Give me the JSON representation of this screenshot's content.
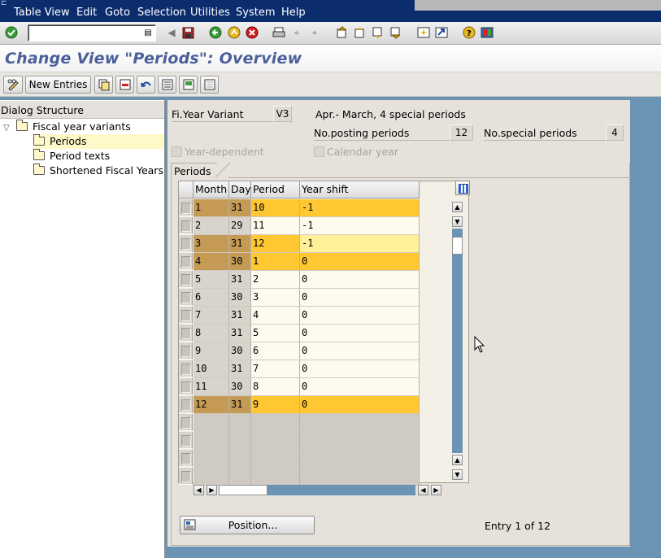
{
  "menubar": {
    "items": [
      "Table View",
      "Edit",
      "Goto",
      "Selection",
      "Utilities",
      "System",
      "Help"
    ]
  },
  "title": "Change View \"Periods\": Overview",
  "apptoolbar": {
    "new_entries": "New Entries"
  },
  "dialog_structure": {
    "header": "Dialog Structure",
    "nodes": [
      "Fiscal year variants",
      "Periods",
      "Period texts",
      "Shortened Fiscal Years"
    ]
  },
  "header_fields": {
    "fy_variant_label": "Fi.Year Variant",
    "fy_variant_value": "V3",
    "fy_variant_desc": "Apr.- March, 4 special periods",
    "posting_periods_label": "No.posting periods",
    "posting_periods_value": "12",
    "special_periods_label": "No.special periods",
    "special_periods_value": "4",
    "year_dependent_label": "Year-dependent",
    "calendar_year_label": "Calendar year"
  },
  "periods_group": {
    "title": "Periods",
    "columns": [
      "Month",
      "Day",
      "Period",
      "Year shift"
    ],
    "rows": [
      {
        "month": "1",
        "day": "31",
        "period": "10",
        "shift": "-1"
      },
      {
        "month": "2",
        "day": "29",
        "period": "11",
        "shift": "-1"
      },
      {
        "month": "3",
        "day": "31",
        "period": "12",
        "shift": "-1"
      },
      {
        "month": "4",
        "day": "30",
        "period": "1",
        "shift": "0"
      },
      {
        "month": "5",
        "day": "31",
        "period": "2",
        "shift": "0"
      },
      {
        "month": "6",
        "day": "30",
        "period": "3",
        "shift": "0"
      },
      {
        "month": "7",
        "day": "31",
        "period": "4",
        "shift": "0"
      },
      {
        "month": "8",
        "day": "31",
        "period": "5",
        "shift": "0"
      },
      {
        "month": "9",
        "day": "30",
        "period": "6",
        "shift": "0"
      },
      {
        "month": "10",
        "day": "31",
        "period": "7",
        "shift": "0"
      },
      {
        "month": "11",
        "day": "30",
        "period": "8",
        "shift": "0"
      },
      {
        "month": "12",
        "day": "31",
        "period": "9",
        "shift": "0"
      }
    ],
    "position_button": "Position...",
    "entry_info": "Entry 1 of 12"
  },
  "colors": {
    "menubar_bg": "#0b2d6e",
    "title_text": "#4a5f9b",
    "row_highlight": "#ffc732",
    "row_highlight_key": "#c49a55",
    "row_normal": "#fffaee",
    "row_normal_key": "#d8d4cc",
    "row_focus": "#fff09a",
    "desktop_bg": "#6b93b3"
  }
}
